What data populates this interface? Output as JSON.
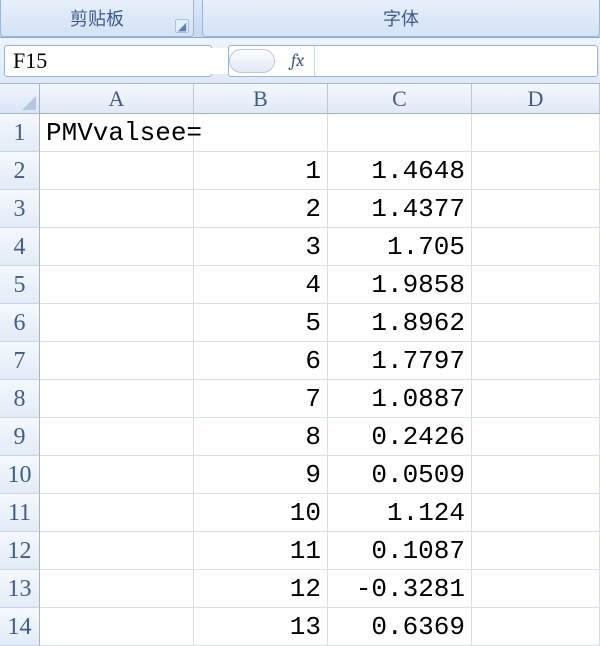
{
  "ribbon": {
    "clipboard_label": "剪贴板",
    "font_label": "字体"
  },
  "namebox": {
    "value": "F15"
  },
  "fx": {
    "label": "fx",
    "value": ""
  },
  "columns": [
    "A",
    "B",
    "C",
    "D"
  ],
  "rows": [
    {
      "n": "1",
      "A": "PMVvalsee=",
      "B": "",
      "C": "",
      "D": ""
    },
    {
      "n": "2",
      "A": "",
      "B": "1",
      "C": "1.4648",
      "D": ""
    },
    {
      "n": "3",
      "A": "",
      "B": "2",
      "C": "1.4377",
      "D": ""
    },
    {
      "n": "4",
      "A": "",
      "B": "3",
      "C": "1.705",
      "D": ""
    },
    {
      "n": "5",
      "A": "",
      "B": "4",
      "C": "1.9858",
      "D": ""
    },
    {
      "n": "6",
      "A": "",
      "B": "5",
      "C": "1.8962",
      "D": ""
    },
    {
      "n": "7",
      "A": "",
      "B": "6",
      "C": "1.7797",
      "D": ""
    },
    {
      "n": "8",
      "A": "",
      "B": "7",
      "C": "1.0887",
      "D": ""
    },
    {
      "n": "9",
      "A": "",
      "B": "8",
      "C": "0.2426",
      "D": ""
    },
    {
      "n": "10",
      "A": "",
      "B": "9",
      "C": "0.0509",
      "D": ""
    },
    {
      "n": "11",
      "A": "",
      "B": "10",
      "C": "1.124",
      "D": ""
    },
    {
      "n": "12",
      "A": "",
      "B": "11",
      "C": "0.1087",
      "D": ""
    },
    {
      "n": "13",
      "A": "",
      "B": "12",
      "C": "-0.3281",
      "D": ""
    },
    {
      "n": "14",
      "A": "",
      "B": "13",
      "C": "0.6369",
      "D": ""
    }
  ]
}
